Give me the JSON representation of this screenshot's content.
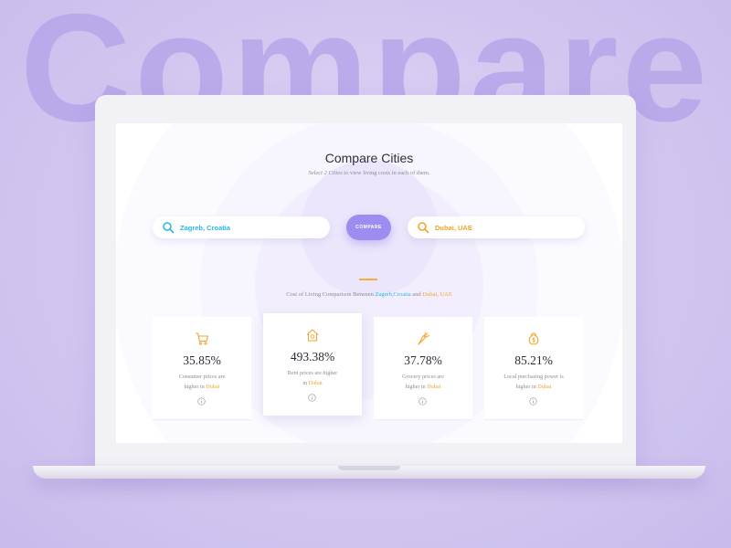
{
  "hero_word": "Compare",
  "page": {
    "title": "Compare Cities",
    "subtitle_emphasis": "Select 2 Cities",
    "subtitle_rest": "to view living costs in each of them."
  },
  "search": {
    "left_value": "Zagreb, Croatia",
    "right_value": "Dubai, UAE",
    "compare_label": "COMPARE"
  },
  "comparison": {
    "prefix": "Cost of Living Comparison Between",
    "city_a": "Zagreb,Croatia",
    "and": "and",
    "city_b": "Dubai, UAE"
  },
  "cards": [
    {
      "icon": "cart-icon",
      "percent": "35.85%",
      "line1": "Consumer prices are",
      "line2": "higher in",
      "city": "Dubai"
    },
    {
      "icon": "house-icon",
      "percent": "493.38%",
      "line1": "Rent prices are higher",
      "line2": "in",
      "city": "Dubai"
    },
    {
      "icon": "carrot-icon",
      "percent": "37.78%",
      "line1": "Grocery prices are",
      "line2": "higher in",
      "city": "Dubai"
    },
    {
      "icon": "money-bag-icon",
      "percent": "85.21%",
      "line1": "Local purchasing power is",
      "line2": "higher in",
      "city": "Dubai"
    }
  ],
  "colors": {
    "accent_purple": "#9e8df0",
    "city_a_blue": "#2ab7e6",
    "city_b_orange": "#f2a52b",
    "background": "#d3c7f0"
  }
}
